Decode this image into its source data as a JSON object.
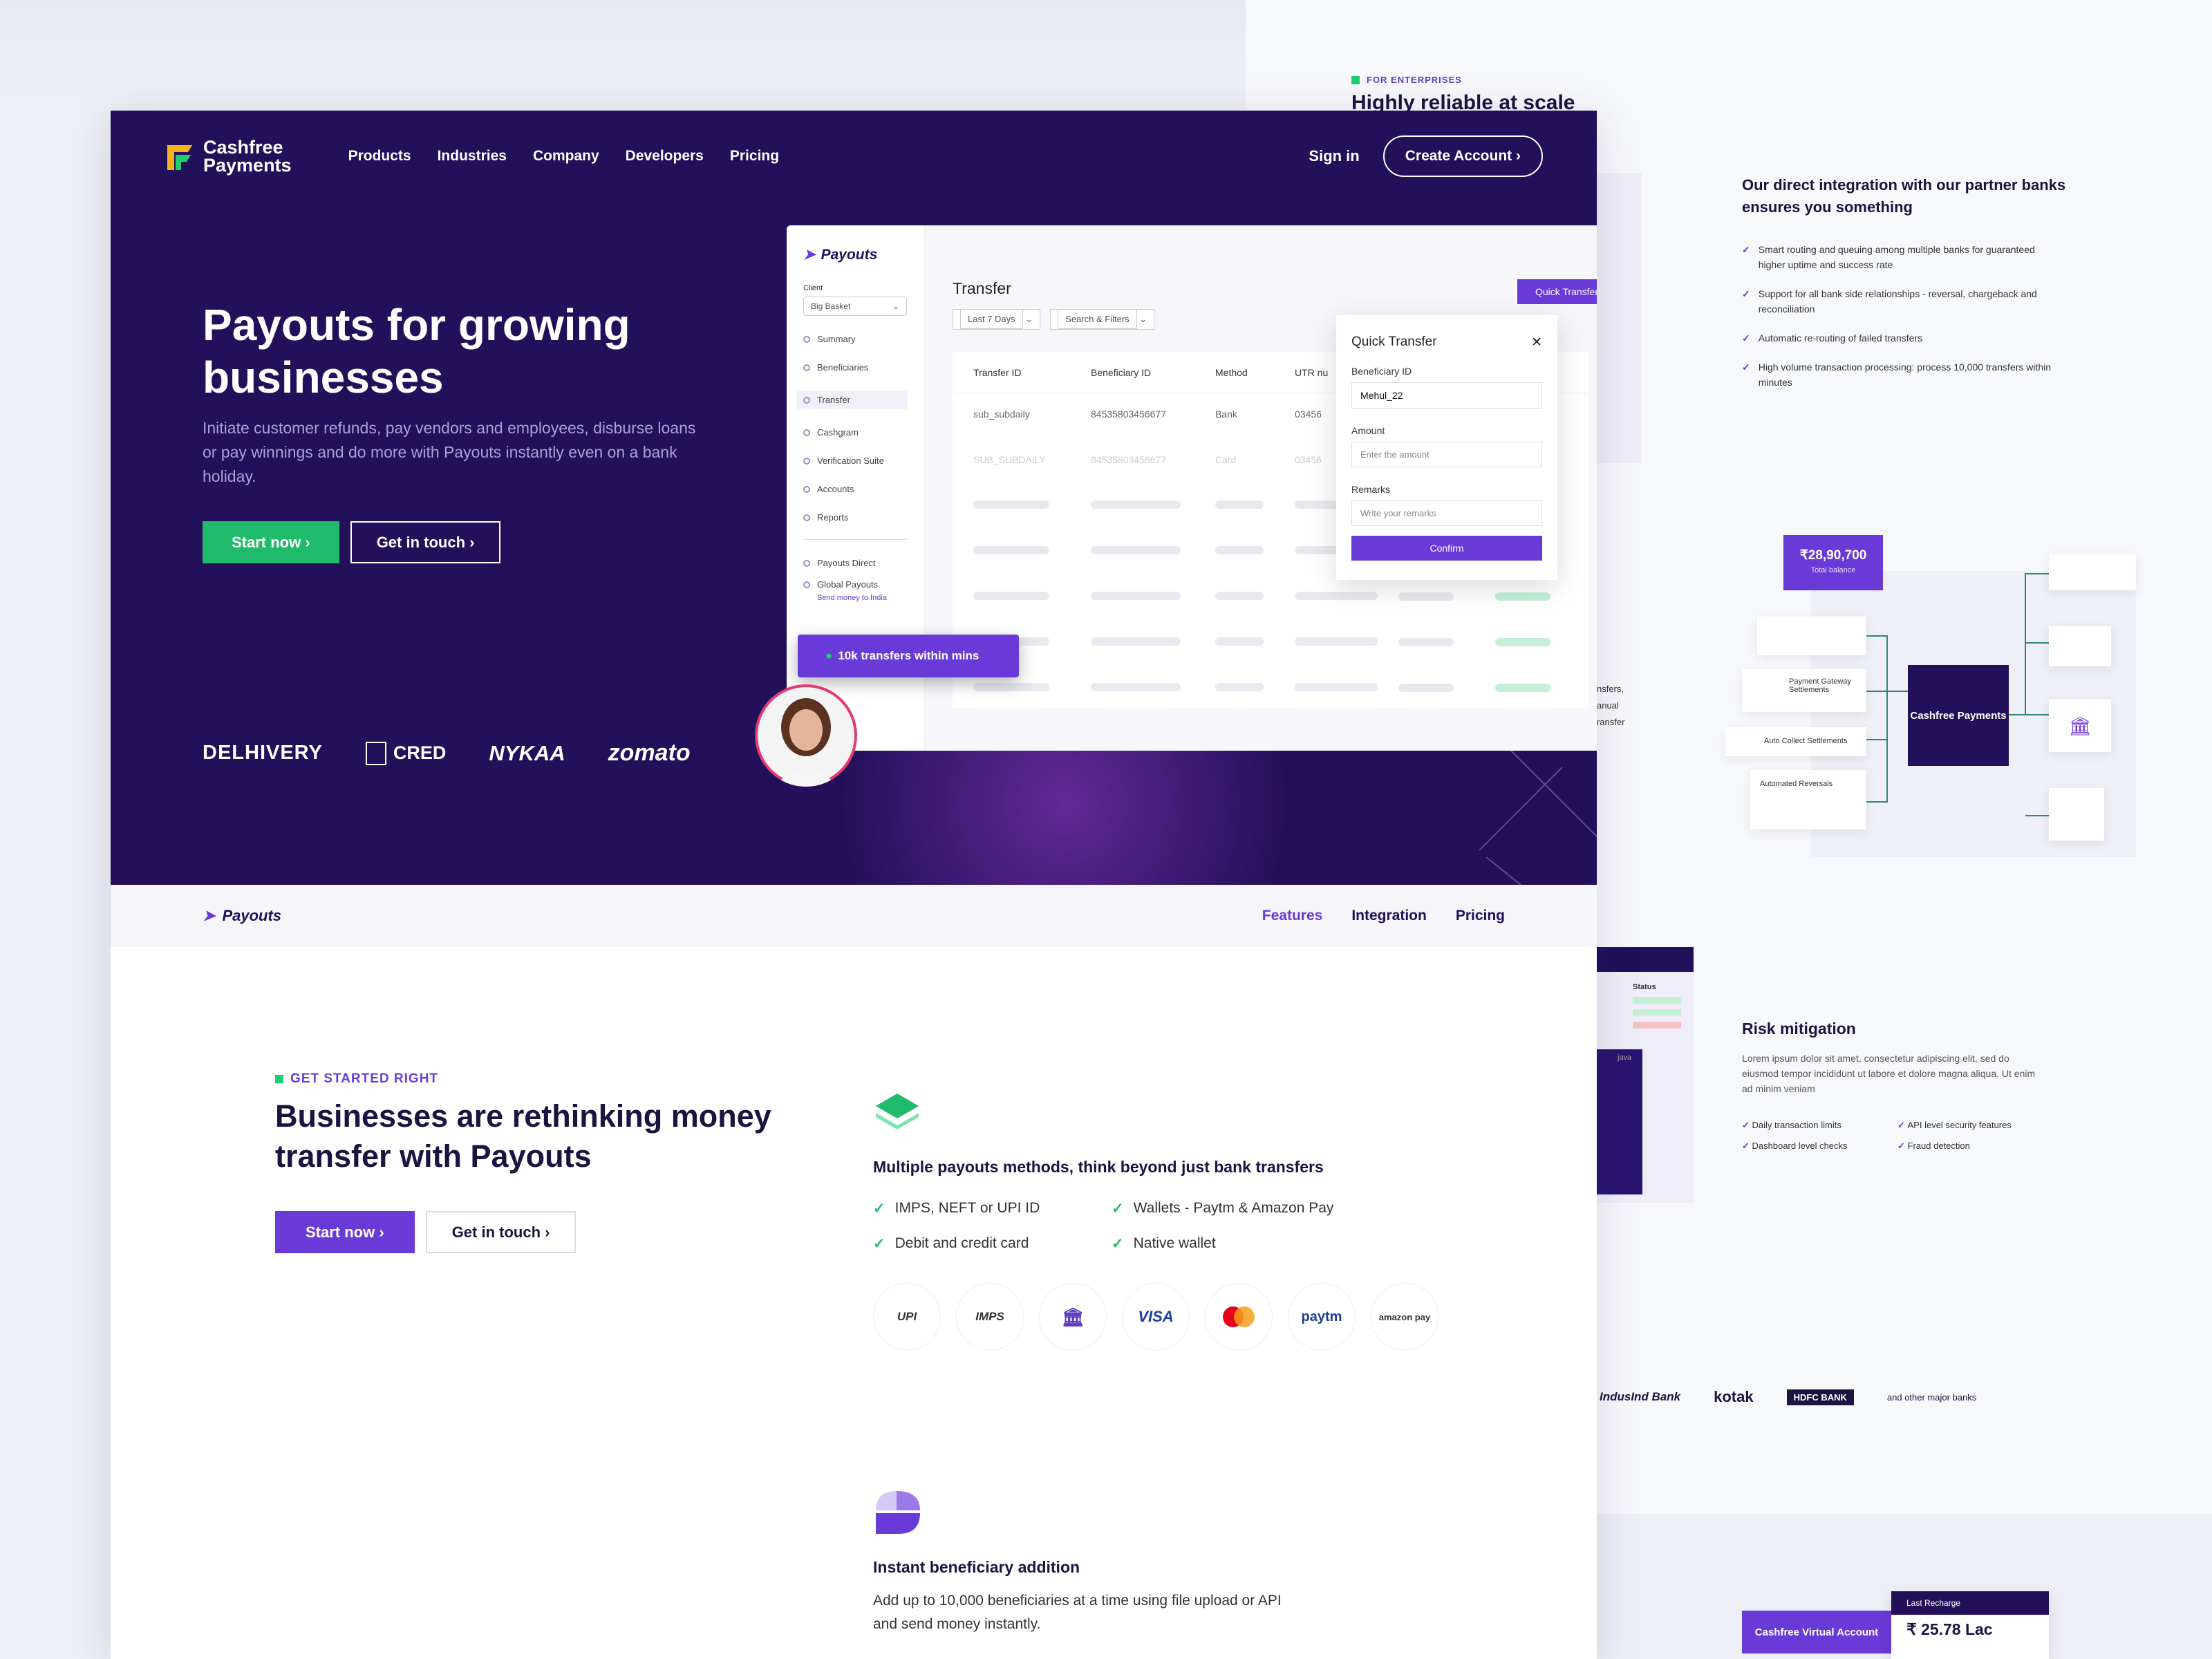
{
  "nav": {
    "logo_line1": "Cashfree",
    "logo_line2": "Payments",
    "links": [
      "Products",
      "Industries",
      "Company",
      "Developers",
      "Pricing"
    ],
    "sign_in": "Sign in",
    "create_account": "Create Account"
  },
  "hero": {
    "title": "Payouts for growing businesses",
    "subtitle": "Initiate customer refunds, pay vendors and employees, disburse loans or pay winnings and do more with Payouts instantly even on a bank holiday.",
    "start_now": "Start now",
    "get_in_touch": "Get in touch",
    "brands": [
      "DELHIVERY",
      "CRED",
      "NYKAA",
      "zomato"
    ],
    "pill": "10k transfers within mins"
  },
  "dashboard": {
    "product": "Payouts",
    "client_label": "Client",
    "client_value": "Big Basket",
    "menu": [
      "Summary",
      "Beneficiaries",
      "Transfer",
      "Cashgram",
      "Verification Suite",
      "Accounts",
      "Reports"
    ],
    "menu2": [
      "Payouts Direct",
      "Global Payouts"
    ],
    "send_money": "Send money to India",
    "title": "Transfer",
    "quick_transfer_btn": "Quick Transfer",
    "filter1": "Last 7 Days",
    "filter2": "Search & Filters",
    "columns": [
      "Transfer ID",
      "Beneficiary ID",
      "Method",
      "UTR nu"
    ],
    "rows": [
      [
        "sub_subdaily",
        "84535803456677",
        "Bank",
        "03456"
      ],
      [
        "SUB_SUBDAILY",
        "84535803456677",
        "Card",
        "03456"
      ]
    ]
  },
  "quick_transfer": {
    "title": "Quick Transfer",
    "beneficiary_label": "Beneficiary ID",
    "beneficiary_value": "Mehul_22",
    "amount_label": "Amount",
    "amount_placeholder": "Enter the amount",
    "remarks_label": "Remarks",
    "remarks_placeholder": "Write your remarks",
    "confirm": "Confirm"
  },
  "subnav": {
    "product": "Payouts",
    "links": [
      "Features",
      "Integration",
      "Pricing"
    ]
  },
  "section": {
    "tag": "GET STARTED RIGHT",
    "title": "Businesses are rethinking money transfer with Payouts",
    "start_now": "Start now",
    "get_in_touch": "Get in touch"
  },
  "feature1": {
    "title": "Multiple payouts methods, think beyond just bank transfers",
    "items": [
      "IMPS, NEFT or UPI ID",
      "Wallets - Paytm & Amazon Pay",
      "Debit and credit card",
      "Native wallet"
    ],
    "methods": [
      "UPI",
      "IMPS",
      "BANK",
      "VISA",
      "MC",
      "paytm",
      "amazon pay"
    ]
  },
  "feature2": {
    "title": "Instant beneficiary addition",
    "desc": "Add up to 10,000 beneficiaries at a time using file upload or API and send money instantly."
  },
  "right_page": {
    "tag": "FOR ENTERPRISES",
    "title": "Highly reliable at scale",
    "integration_title": "Our direct integration with our partner banks ensures you something",
    "bullets": [
      "Smart routing and queuing among multiple banks for guaranteed higher uptime and success rate",
      "Support for all bank side relationships - reversal, chargeback and reconciliation",
      "Automatic re-routing of failed transfers",
      "High volume transaction processing: process 10,000 transfers within minutes"
    ],
    "balance": "₹28,90,700",
    "balance_label": "Total balance",
    "flow_items": [
      "Payment Gateway Settlements",
      "Auto Collect Settlements",
      "Automated Reversals"
    ],
    "hub": "Cashfree Payments",
    "risk_title": "Risk mitigation",
    "risk_desc": "Lorem ipsum dolor sit amet, consectetur adipiscing elit, sed do eiusmod tempor incididunt ut labore et dolore magna aliqua. Ut enim ad minim veniam",
    "risk_items": [
      "Daily transaction limits",
      "API level security features",
      "Dashboard level checks",
      "Fraud detection"
    ],
    "banks": [
      "IndusInd Bank",
      "kotak",
      "HDFC BANK",
      "and other major banks"
    ],
    "virtual_account": "Cashfree Virtual Account",
    "last_recharge": "Last Recharge",
    "recharge_value": "₹ 25.78 Lac",
    "status": "Status",
    "java": "java",
    "partial_text": [
      "nsfers,",
      "anual",
      "ransfer"
    ]
  }
}
